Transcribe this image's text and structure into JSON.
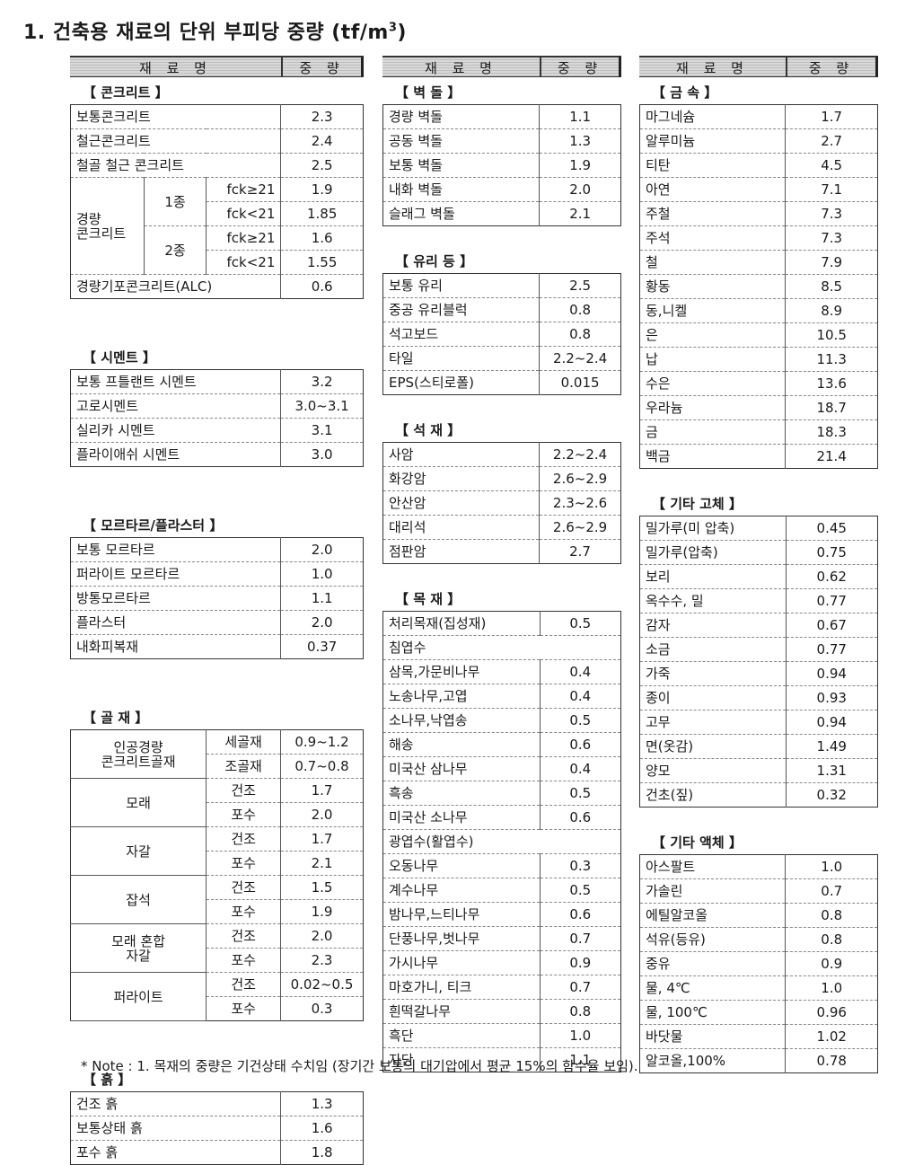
{
  "title": "1. 건축용 재료의 단위 부피당 중량 (tf/m",
  "title_sup": "3",
  "title_end": ")",
  "header": {
    "name": "재 료 명",
    "weight": "중 량"
  },
  "col1": {
    "concrete": {
      "title": "【 콘크리트 】",
      "rows": [
        {
          "name": "보통콘크리트",
          "value": "2.3"
        },
        {
          "name": "철근콘크리트",
          "value": "2.4"
        },
        {
          "name": "철골 철근 콘크리트",
          "value": "2.5"
        }
      ],
      "lightweight": {
        "label": "경량\n콘크리트",
        "type1": "1종",
        "type2": "2종",
        "rows": [
          {
            "cond": "fck≥21",
            "value": "1.9"
          },
          {
            "cond": "fck<21",
            "value": "1.85"
          },
          {
            "cond": "fck≥21",
            "value": "1.6"
          },
          {
            "cond": "fck<21",
            "value": "1.55"
          }
        ]
      },
      "alc": {
        "name": "경량기포콘크리트(ALC)",
        "value": "0.6"
      }
    },
    "cement": {
      "title": "【 시멘트 】",
      "rows": [
        {
          "name": "보통 프틀랜트 시멘트",
          "value": "3.2"
        },
        {
          "name": "고로시멘트",
          "value": "3.0~3.1"
        },
        {
          "name": "실리카 시멘트",
          "value": "3.1"
        },
        {
          "name": "플라이애쉬 시멘트",
          "value": "3.0"
        }
      ]
    },
    "mortar": {
      "title": "【 모르타르/플라스터 】",
      "rows": [
        {
          "name": "보통 모르타르",
          "value": "2.0"
        },
        {
          "name": "퍼라이트 모르타르",
          "value": "1.0"
        },
        {
          "name": "방통모르타르",
          "value": "1.1"
        },
        {
          "name": "플라스터",
          "value": "2.0"
        },
        {
          "name": "내화피복재",
          "value": "0.37"
        }
      ]
    },
    "aggregate": {
      "title": "【 골 재 】",
      "groups": [
        {
          "label": "인공경량\n콘크리트골재",
          "rows": [
            {
              "cond": "세골재",
              "value": "0.9~1.2"
            },
            {
              "cond": "조골재",
              "value": "0.7~0.8"
            }
          ]
        },
        {
          "label": "모래",
          "rows": [
            {
              "cond": "건조",
              "value": "1.7"
            },
            {
              "cond": "포수",
              "value": "2.0"
            }
          ]
        },
        {
          "label": "자갈",
          "rows": [
            {
              "cond": "건조",
              "value": "1.7"
            },
            {
              "cond": "포수",
              "value": "2.1"
            }
          ]
        },
        {
          "label": "잡석",
          "rows": [
            {
              "cond": "건조",
              "value": "1.5"
            },
            {
              "cond": "포수",
              "value": "1.9"
            }
          ]
        },
        {
          "label": "모래 혼합\n자갈",
          "rows": [
            {
              "cond": "건조",
              "value": "2.0"
            },
            {
              "cond": "포수",
              "value": "2.3"
            }
          ]
        },
        {
          "label": "퍼라이트",
          "rows": [
            {
              "cond": "건조",
              "value": "0.02~0.5"
            },
            {
              "cond": "포수",
              "value": "0.3"
            }
          ]
        }
      ]
    },
    "soil": {
      "title": "【 흙 】",
      "rows": [
        {
          "name": "건조 흙",
          "value": "1.3"
        },
        {
          "name": "보통상태 흙",
          "value": "1.6"
        },
        {
          "name": "포수 흙",
          "value": "1.8"
        }
      ]
    }
  },
  "col2": {
    "brick": {
      "title": "【 벽 돌 】",
      "rows": [
        {
          "name": "경량 벽돌",
          "value": "1.1"
        },
        {
          "name": "공동 벽돌",
          "value": "1.3"
        },
        {
          "name": "보통 벽돌",
          "value": "1.9"
        },
        {
          "name": "내화 벽돌",
          "value": "2.0"
        },
        {
          "name": "슬래그 벽돌",
          "value": "2.1"
        }
      ]
    },
    "glass": {
      "title": "【 유리 등 】",
      "rows": [
        {
          "name": "보통 유리",
          "value": "2.5"
        },
        {
          "name": "중공 유리블럭",
          "value": "0.8"
        },
        {
          "name": "석고보드",
          "value": "0.8"
        },
        {
          "name": "타일",
          "value": "2.2~2.4"
        },
        {
          "name": "EPS(스티로폴)",
          "value": "0.015"
        }
      ]
    },
    "stone": {
      "title": "【 석 재 】",
      "rows": [
        {
          "name": "사암",
          "value": "2.2~2.4"
        },
        {
          "name": "화강암",
          "value": "2.6~2.9"
        },
        {
          "name": "안산암",
          "value": "2.3~2.6"
        },
        {
          "name": "대리석",
          "value": "2.6~2.9"
        },
        {
          "name": "점판암",
          "value": "2.7"
        }
      ]
    },
    "wood": {
      "title": "【 목 재 】",
      "rows": [
        {
          "name": "처리목재(집성재)",
          "value": "0.5"
        },
        {
          "name": "침엽수",
          "value": "",
          "heading": true
        },
        {
          "name": "삼목,가문비나무",
          "value": "0.4"
        },
        {
          "name": "노송나무,고엽",
          "value": "0.4"
        },
        {
          "name": "소나무,낙엽송",
          "value": "0.5"
        },
        {
          "name": "해송",
          "value": "0.6"
        },
        {
          "name": "미국산 삼나무",
          "value": "0.4"
        },
        {
          "name": "흑송",
          "value": "0.5"
        },
        {
          "name": "미국산 소나무",
          "value": "0.6"
        },
        {
          "name": "광엽수(활엽수)",
          "value": "",
          "heading": true
        },
        {
          "name": "오동나무",
          "value": "0.3"
        },
        {
          "name": "계수나무",
          "value": "0.5"
        },
        {
          "name": "밤나무,느티나무",
          "value": "0.6"
        },
        {
          "name": "단풍나무,벗나무",
          "value": "0.7"
        },
        {
          "name": "가시나무",
          "value": "0.9"
        },
        {
          "name": "마호가니, 티크",
          "value": "0.7"
        },
        {
          "name": "흰떡갈나무",
          "value": "0.8"
        },
        {
          "name": "흑단",
          "value": "1.0"
        },
        {
          "name": "자단",
          "value": "1.1"
        }
      ]
    }
  },
  "col3": {
    "metal": {
      "title": "【 금 속 】",
      "rows": [
        {
          "name": "마그네슘",
          "value": "1.7"
        },
        {
          "name": "알루미늄",
          "value": "2.7"
        },
        {
          "name": "티탄",
          "value": "4.5"
        },
        {
          "name": "아연",
          "value": "7.1"
        },
        {
          "name": "주철",
          "value": "7.3"
        },
        {
          "name": "주석",
          "value": "7.3"
        },
        {
          "name": "철",
          "value": "7.9"
        },
        {
          "name": "황동",
          "value": "8.5"
        },
        {
          "name": "동,니켈",
          "value": "8.9"
        },
        {
          "name": "은",
          "value": "10.5"
        },
        {
          "name": "납",
          "value": "11.3"
        },
        {
          "name": "수은",
          "value": "13.6"
        },
        {
          "name": "우라늄",
          "value": "18.7"
        },
        {
          "name": "금",
          "value": "18.3"
        },
        {
          "name": "백금",
          "value": "21.4"
        }
      ]
    },
    "solid": {
      "title": "【 기타 고체 】",
      "rows": [
        {
          "name": "밀가루(미 압축)",
          "value": "0.45"
        },
        {
          "name": "밀가루(압축)",
          "value": "0.75"
        },
        {
          "name": "보리",
          "value": "0.62"
        },
        {
          "name": "옥수수, 밀",
          "value": "0.77"
        },
        {
          "name": "감자",
          "value": "0.67"
        },
        {
          "name": "소금",
          "value": "0.77"
        },
        {
          "name": "가죽",
          "value": "0.94"
        },
        {
          "name": "종이",
          "value": "0.93"
        },
        {
          "name": "고무",
          "value": "0.94"
        },
        {
          "name": "면(옷감)",
          "value": "1.49"
        },
        {
          "name": "양모",
          "value": "1.31"
        },
        {
          "name": "건초(짚)",
          "value": "0.32"
        }
      ]
    },
    "liquid": {
      "title": "【 기타 액체 】",
      "rows": [
        {
          "name": "아스팔트",
          "value": "1.0"
        },
        {
          "name": "가솔린",
          "value": "0.7"
        },
        {
          "name": "에틸알코올",
          "value": "0.8"
        },
        {
          "name": "석유(등유)",
          "value": "0.8"
        },
        {
          "name": "중유",
          "value": "0.9"
        },
        {
          "name": "물, 4℃",
          "value": "1.0"
        },
        {
          "name": "물, 100℃",
          "value": "0.96"
        },
        {
          "name": "바닷물",
          "value": "1.02"
        },
        {
          "name": "알코올,100%",
          "value": "0.78"
        }
      ]
    }
  },
  "note": "* Note : 1. 목재의 중량은 기건상태 수치임 (장기간 보통의 대기압에서 평균 15%의 함수율 보임)."
}
